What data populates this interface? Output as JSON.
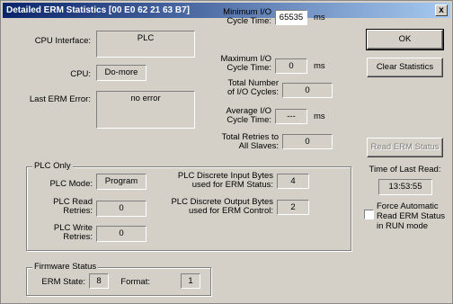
{
  "window": {
    "title": "Detailed ERM Statistics [00 E0 62 21 63 B7]",
    "close_label": "x"
  },
  "left": {
    "cpu_interface_label": "CPU Interface:",
    "cpu_interface_value": "PLC",
    "cpu_label": "CPU:",
    "cpu_value": "Do-more",
    "last_error_label": "Last ERM Error:",
    "last_error_value": "no error"
  },
  "middle": {
    "min_io_label": [
      "Minimum I/O",
      "Cycle Time:"
    ],
    "min_io_value": "65535",
    "min_io_unit": "ms",
    "max_io_label": [
      "Maximum I/O",
      "Cycle Time:"
    ],
    "max_io_value": "0",
    "max_io_unit": "ms",
    "total_cycles_label": [
      "Total Number",
      "of I/O Cycles:"
    ],
    "total_cycles_value": "0",
    "avg_io_label": [
      "Average I/O",
      "Cycle Time:"
    ],
    "avg_io_value": "---",
    "avg_io_unit": "ms",
    "total_retries_label": [
      "Total Retries to",
      "All Slaves:"
    ],
    "total_retries_value": "0"
  },
  "right": {
    "ok_label": "OK",
    "clear_label": "Clear Statistics",
    "read_label": "Read ERM Status",
    "time_last_read_label": "Time of Last Read:",
    "time_last_read_value": "13:53:55",
    "force_auto_label": [
      "Force Automatic",
      "Read ERM Status",
      "in RUN mode"
    ],
    "force_auto_checked": false
  },
  "plc_only": {
    "title": "PLC Only",
    "mode_label": "PLC Mode:",
    "mode_value": "Program",
    "read_retries_label": [
      "PLC Read",
      "Retries:"
    ],
    "read_retries_value": "0",
    "write_retries_label": [
      "PLC Write",
      "Retries:"
    ],
    "write_retries_value": "0",
    "input_bytes_label": [
      "PLC Discrete Input Bytes",
      "used for ERM Status:"
    ],
    "input_bytes_value": "4",
    "output_bytes_label": [
      "PLC Discrete Output Bytes",
      "used for ERM Control:"
    ],
    "output_bytes_value": "2"
  },
  "firmware": {
    "title": "Firmware Status",
    "state_label": "ERM State:",
    "state_value": "8",
    "format_label": "Format:",
    "format_value": "1"
  }
}
